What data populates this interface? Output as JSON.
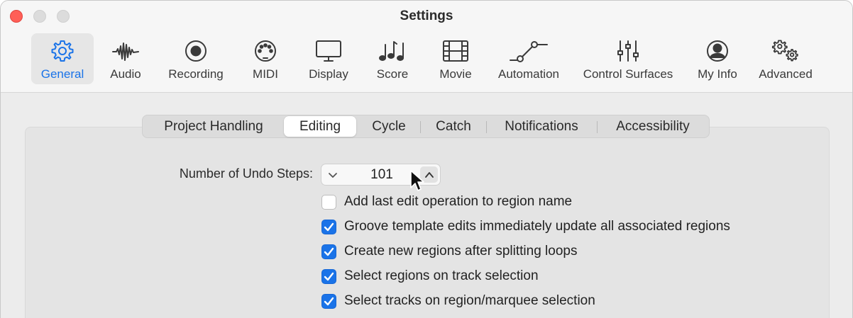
{
  "window": {
    "title": "Settings"
  },
  "toolbar": {
    "items": [
      {
        "label": "General",
        "icon": "gear-icon",
        "active": true
      },
      {
        "label": "Audio",
        "icon": "waveform-icon"
      },
      {
        "label": "Recording",
        "icon": "record-icon"
      },
      {
        "label": "MIDI",
        "icon": "midi-connector-icon"
      },
      {
        "label": "Display",
        "icon": "monitor-icon"
      },
      {
        "label": "Score",
        "icon": "music-notes-icon"
      },
      {
        "label": "Movie",
        "icon": "film-icon"
      },
      {
        "label": "Automation",
        "icon": "automation-curve-icon"
      },
      {
        "label": "Control Surfaces",
        "icon": "faders-icon"
      },
      {
        "label": "My Info",
        "icon": "person-icon"
      },
      {
        "label": "Advanced",
        "icon": "gears-icon"
      }
    ]
  },
  "tabs": [
    {
      "label": "Project Handling"
    },
    {
      "label": "Editing",
      "active": true
    },
    {
      "label": "Cycle"
    },
    {
      "label": "Catch"
    },
    {
      "label": "Notifications"
    },
    {
      "label": "Accessibility"
    }
  ],
  "editing": {
    "undo_label": "Number of Undo Steps:",
    "undo_value": "101",
    "options": [
      {
        "label": "Add last edit operation to region name",
        "checked": false
      },
      {
        "label": "Groove template edits immediately update all associated regions",
        "checked": true
      },
      {
        "label": "Create new regions after splitting loops",
        "checked": true
      },
      {
        "label": "Select regions on track selection",
        "checked": true
      },
      {
        "label": "Select tracks on region/marquee selection",
        "checked": true
      }
    ]
  },
  "colors": {
    "accent": "#1a73e8",
    "close": "#ff5f57"
  }
}
